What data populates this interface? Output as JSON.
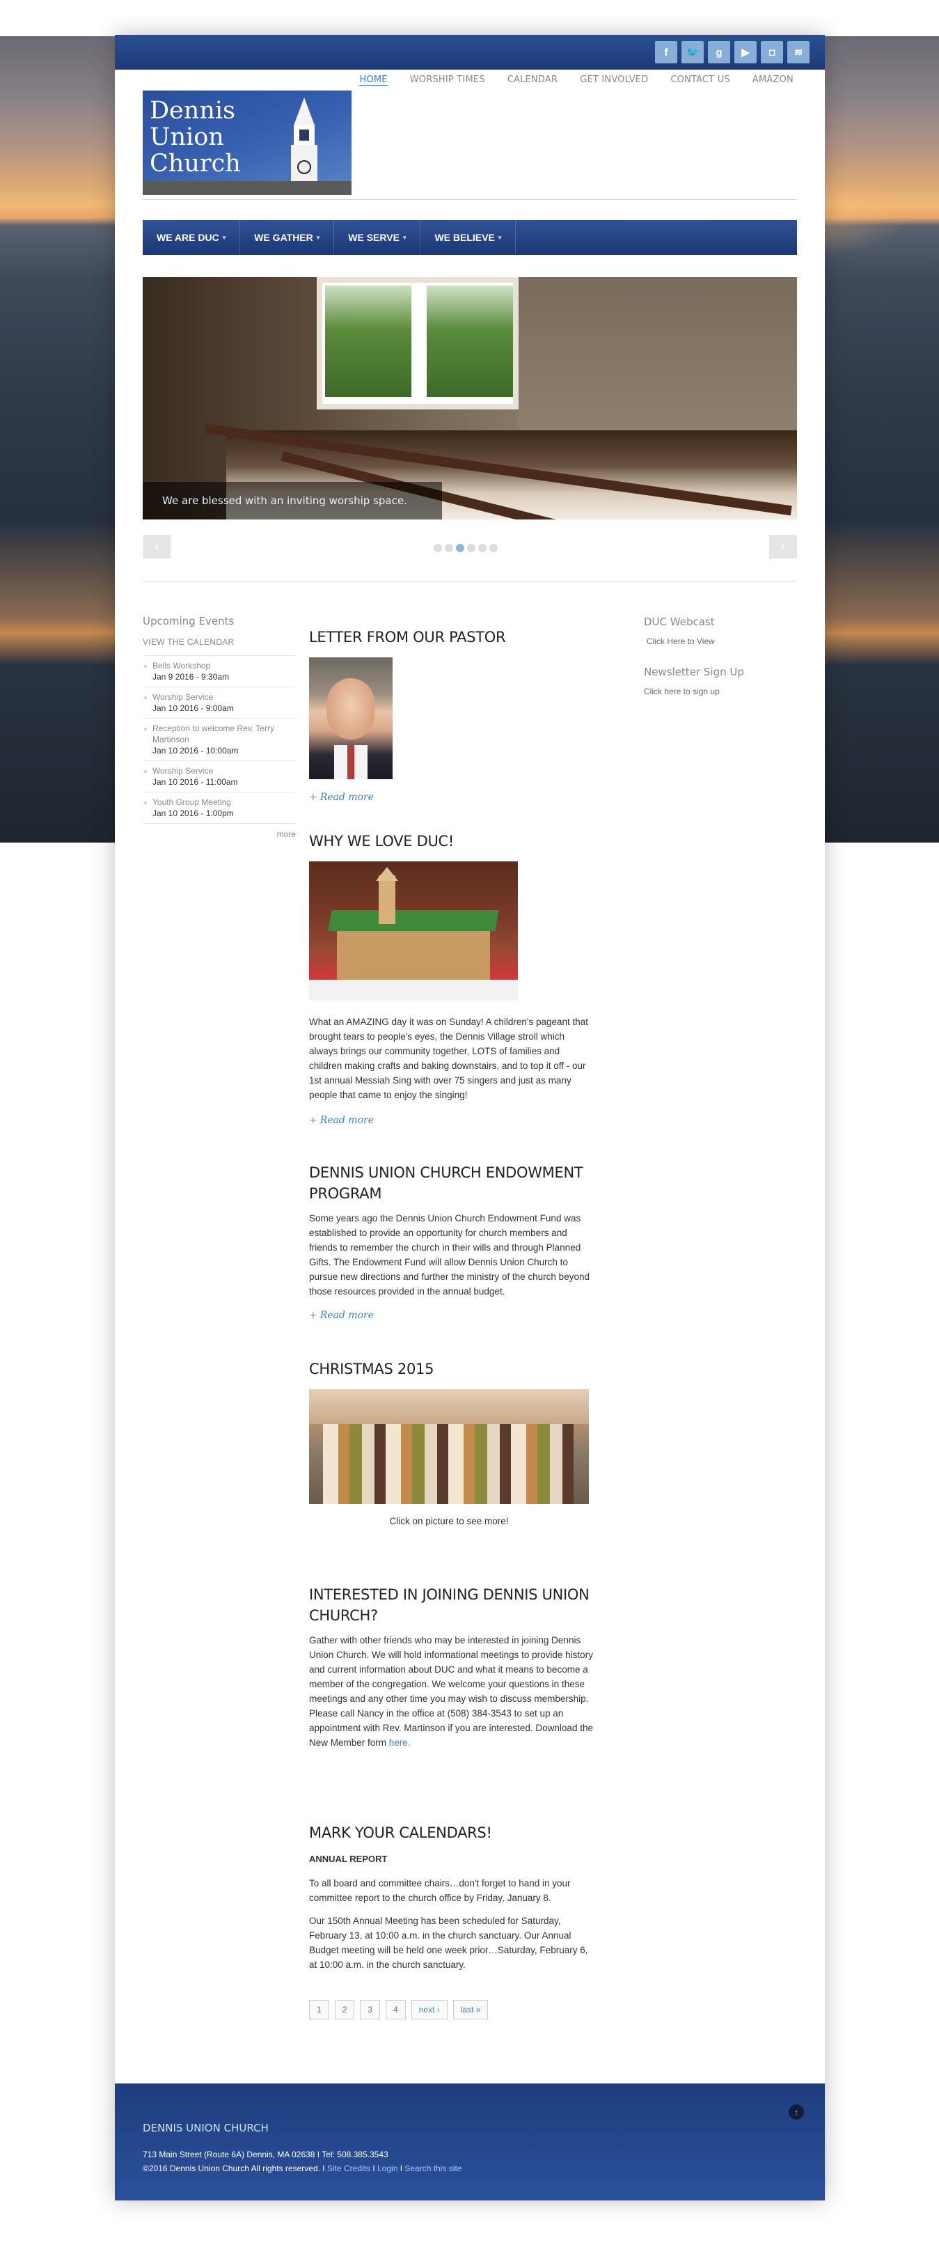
{
  "social": {
    "icons": [
      "facebook-icon",
      "twitter-icon",
      "google-plus-icon",
      "youtube-icon",
      "instagram-icon",
      "rss-icon"
    ],
    "glyphs": [
      "f",
      "🐦",
      "g",
      "▶",
      "◘",
      "≋"
    ]
  },
  "topnav": [
    "HOME",
    "WORSHIP TIMES",
    "CALENDAR",
    "GET INVOLVED",
    "CONTACT US",
    "AMAZON"
  ],
  "logo": {
    "line1": "Dennis",
    "line2": "Union",
    "line3": "Church"
  },
  "mainnav": [
    "WE ARE DUC",
    "WE GATHER",
    "WE SERVE",
    "WE BELIEVE"
  ],
  "slider": {
    "caption": "We are blessed with an inviting worship space.",
    "prev": "‹",
    "next": "›",
    "dot_count": 6,
    "active_dot": 3
  },
  "left_sidebar": {
    "title": "Upcoming Events",
    "calendar_link": "VIEW THE CALENDAR",
    "events": [
      {
        "title": "Bells Workshop",
        "date": "Jan 9 2016 - 9:30am"
      },
      {
        "title": "Worship Service",
        "date": "Jan 10 2016 - 9:00am"
      },
      {
        "title": "Reception to welcome Rev. Terry Martinson",
        "date": "Jan 10 2016 - 10:00am"
      },
      {
        "title": "Worship Service",
        "date": "Jan 10 2016 - 11:00am"
      },
      {
        "title": "Youth Group Meeting",
        "date": "Jan 10 2016 - 1:00pm"
      }
    ],
    "more": "more"
  },
  "right_sidebar": {
    "webcast_title": "DUC Webcast",
    "webcast_link": "Click Here to View",
    "newsletter_title": "Newsletter Sign Up",
    "newsletter_link": "Click here to sign up"
  },
  "posts": {
    "pastor": {
      "title": "LETTER FROM OUR PASTOR",
      "read_more": "Read more"
    },
    "love": {
      "title": "WHY WE LOVE DUC!",
      "body": "What an AMAZING day it was on Sunday!  A children's pageant that brought tears to people's eyes, the Dennis Village stroll which always brings our community together, LOTS of families and children making crafts and baking downstairs, and to top it off -  our 1st annual Messiah Sing with over 75 singers and just as many people that came to enjoy the singing!",
      "read_more": "Read more"
    },
    "endowment": {
      "title": "DENNIS UNION CHURCH ENDOWMENT PROGRAM",
      "body": "Some years ago the Dennis Union Church Endowment Fund was established to provide an opportunity for church members and friends to remember the church in their wills and through Planned Gifts.  The Endowment Fund will allow Dennis Union Church to pursue new directions and further the ministry of the church beyond those resources provided in the annual budget.",
      "read_more": "Read more"
    },
    "christmas": {
      "title": "CHRISTMAS 2015",
      "caption": "Click on picture to see more!"
    },
    "joining": {
      "title": "INTERESTED IN JOINING DENNIS UNION CHURCH?",
      "body": "Gather with other friends who may be interested in joining Dennis Union Church. We will hold informational meetings to provide history and current information about DUC and what it means to become a member of the congregation.  We welcome your questions in these meetings and any other time you may wish to discuss membership.  Please call Nancy in the office at (508) 384-3543 to set up an appointment with Rev. Martinson if you are interested. Download the New Member form ",
      "link": "here."
    },
    "calendars": {
      "title": "MARK YOUR CALENDARS!",
      "subtitle": "ANNUAL REPORT",
      "p1": "To all board and committee chairs…don't forget to hand in your committee report to the church office by Friday, January 8.",
      "p2": "Our 150th Annual Meeting has been scheduled for Saturday, February 13, at 10:00 a.m. in the church sanctuary.  Our Annual Budget meeting will be held one week prior…Saturday, February 6, at 10:00 a.m. in the church sanctuary."
    }
  },
  "pager": [
    "1",
    "2",
    "3",
    "4",
    "next ›",
    "last »"
  ],
  "footer": {
    "title": "DENNIS UNION CHURCH",
    "address": "713 Main Street (Route 6A) Dennis, MA 02638 I  Tel: 508.385.3543",
    "copyright": "©2016 Dennis Union Church All rights reserved. I ",
    "credits": "Site Credits",
    "sep1": " I ",
    "login": "Login",
    "sep2": " I ",
    "search": "Search this site",
    "totop": "↑"
  },
  "colors": {
    "brand_blue": "#1f3f80",
    "link": "#3d7fc9"
  }
}
